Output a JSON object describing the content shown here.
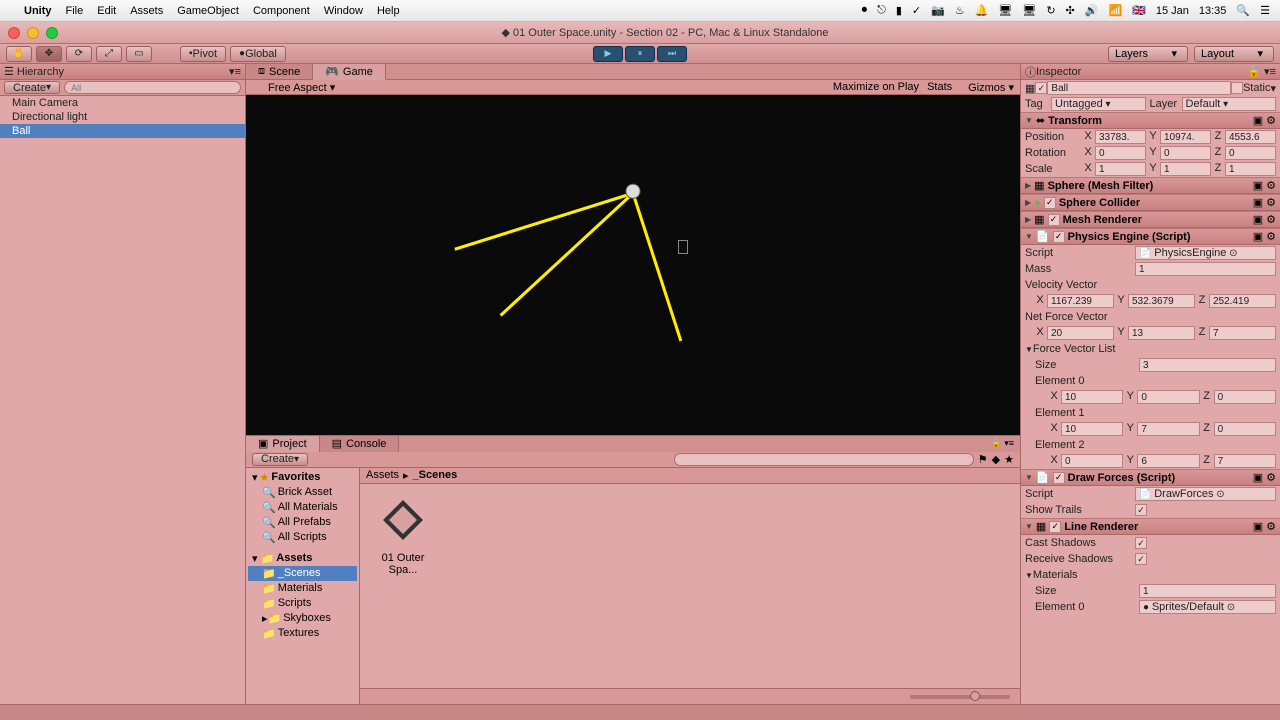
{
  "menubar": {
    "app": "Unity",
    "items": [
      "File",
      "Edit",
      "Assets",
      "GameObject",
      "Component",
      "Window",
      "Help"
    ],
    "date": "15 Jan",
    "time": "13:35",
    "flag": "🇬🇧"
  },
  "window": {
    "title": "01 Outer Space.unity - Section 02 - PC, Mac & Linux Standalone"
  },
  "toolbar": {
    "pivot": "Pivot",
    "global": "Global",
    "layers": "Layers",
    "layout": "Layout"
  },
  "hierarchy": {
    "title": "Hierarchy",
    "create": "Create",
    "search_placeholder": "All",
    "items": [
      "Main Camera",
      "Directional light",
      "Ball"
    ],
    "selected": 2
  },
  "tabs": {
    "scene": "Scene",
    "game": "Game"
  },
  "game_toolbar": {
    "aspect": "Free Aspect",
    "maximize": "Maximize on Play",
    "stats": "Stats",
    "gizmos": "Gizmos"
  },
  "project": {
    "title": "Project",
    "console": "Console",
    "create": "Create",
    "favorites": "Favorites",
    "fav_items": [
      "Brick Asset",
      "All Materials",
      "All Prefabs",
      "All Scripts"
    ],
    "assets": "Assets",
    "folders": [
      "_Scenes",
      "Materials",
      "Scripts",
      "Skyboxes",
      "Textures"
    ],
    "selected_folder": 0,
    "crumb_root": "Assets",
    "crumb_sep": "▸",
    "crumb_cur": "_Scenes",
    "grid": [
      {
        "name": "01 Outer Spa..."
      }
    ]
  },
  "inspector": {
    "title": "Inspector",
    "obj_name": "Ball",
    "static": "Static",
    "tag_lbl": "Tag",
    "tag_val": "Untagged",
    "layer_lbl": "Layer",
    "layer_val": "Default",
    "transform": {
      "title": "Transform",
      "position": "Position",
      "px": "33783.",
      "py": "10974.",
      "pz": "4553.6",
      "rotation": "Rotation",
      "rx": "0",
      "ry": "0",
      "rz": "0",
      "scale": "Scale",
      "sx": "1",
      "sy": "1",
      "sz": "1"
    },
    "sphere_mf": "Sphere (Mesh Filter)",
    "sphere_col": "Sphere Collider",
    "mesh_rend": "Mesh Renderer",
    "physics": {
      "title": "Physics Engine (Script)",
      "script_lbl": "Script",
      "script_val": "PhysicsEngine",
      "mass_lbl": "Mass",
      "mass_val": "1",
      "velvec": "Velocity Vector",
      "vx": "1167.239",
      "vy": "532.3679",
      "vz": "252.419",
      "netforce": "Net Force Vector",
      "nx": "20",
      "ny": "13",
      "nz": "7",
      "fvl": "Force Vector List",
      "size_lbl": "Size",
      "size_val": "3",
      "e0": "Element 0",
      "e0x": "10",
      "e0y": "0",
      "e0z": "0",
      "e1": "Element 1",
      "e1x": "10",
      "e1y": "7",
      "e1z": "0",
      "e2": "Element 2",
      "e2x": "0",
      "e2y": "6",
      "e2z": "7"
    },
    "draw_forces": {
      "title": "Draw Forces (Script)",
      "script_lbl": "Script",
      "script_val": "DrawForces",
      "trails": "Show Trails"
    },
    "line_rend": {
      "title": "Line Renderer",
      "cast": "Cast Shadows",
      "recv": "Receive Shadows",
      "materials": "Materials",
      "size_lbl": "Size",
      "size_val": "1",
      "e0": "Element 0",
      "e0v": "Sprites/Default"
    }
  }
}
